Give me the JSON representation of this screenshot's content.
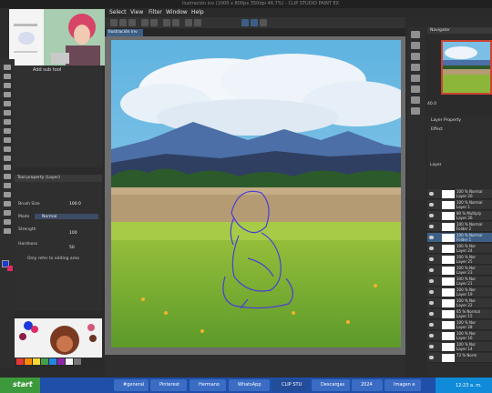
{
  "window": {
    "title": "ilustración inv (1000 x 800px 350dpi 46.7%) - CLIP STUDIO PAINT EX"
  },
  "menu": [
    "Select",
    "View",
    "Filter",
    "Window",
    "Help"
  ],
  "canvas_tab": "Ilustración inv",
  "subtool": {
    "add_label": "Add sub tool"
  },
  "tool_property": {
    "header": "Tool property (Layer)",
    "brush_label": "Brush Size",
    "brush_value": "100.0",
    "mode_label": "Mode",
    "mode_value": "Normal",
    "strength_label": "Strength",
    "strength_value": "100",
    "hardness_label": "Hardness",
    "hardness_value": "50",
    "only_editing_label": "Only refer to editing area"
  },
  "navigator": {
    "header": "Navigator",
    "zoom": "40.0"
  },
  "layer_property": {
    "header": "Layer Property",
    "effect_label": "Effect"
  },
  "layers": {
    "header": "Layer",
    "items": [
      {
        "name": "100 % Normal\nLayer 20"
      },
      {
        "name": "100 % Normal\nLayer 1"
      },
      {
        "name": "80 % Multiply\nLayer 26"
      },
      {
        "name": "100 % Normal\nFolder 2"
      },
      {
        "name": "100 % Normal\nFolder 1",
        "selected": true
      },
      {
        "name": "100 % Nor\nLayer 24"
      },
      {
        "name": "100 % Nor\nLayer 25"
      },
      {
        "name": "100 % Nor\nLayer 23"
      },
      {
        "name": "100 % Nor\nLayer 21"
      },
      {
        "name": "100 % Nor\nLayer 19"
      },
      {
        "name": "100 % Nor\nLayer 22"
      },
      {
        "name": "65 % Normal\nLayer 15"
      },
      {
        "name": "100 % Nor\nLayer 28"
      },
      {
        "name": "100 % Nor\nLayer 16"
      },
      {
        "name": "100 % Nor\nLayer 14"
      },
      {
        "name": "73 % Norm"
      }
    ]
  },
  "taskbar": {
    "start": "start",
    "tasks": [
      "#general",
      "Pinterest",
      "Hermano",
      "WhatsApp",
      "CLIP STU",
      "Descargas",
      "2024",
      "Imagen e"
    ],
    "clock": "12:23 a. m."
  },
  "colors": {
    "foreground": "#1a39d8",
    "background": "#e02a66",
    "accent": "#3d5f86"
  }
}
